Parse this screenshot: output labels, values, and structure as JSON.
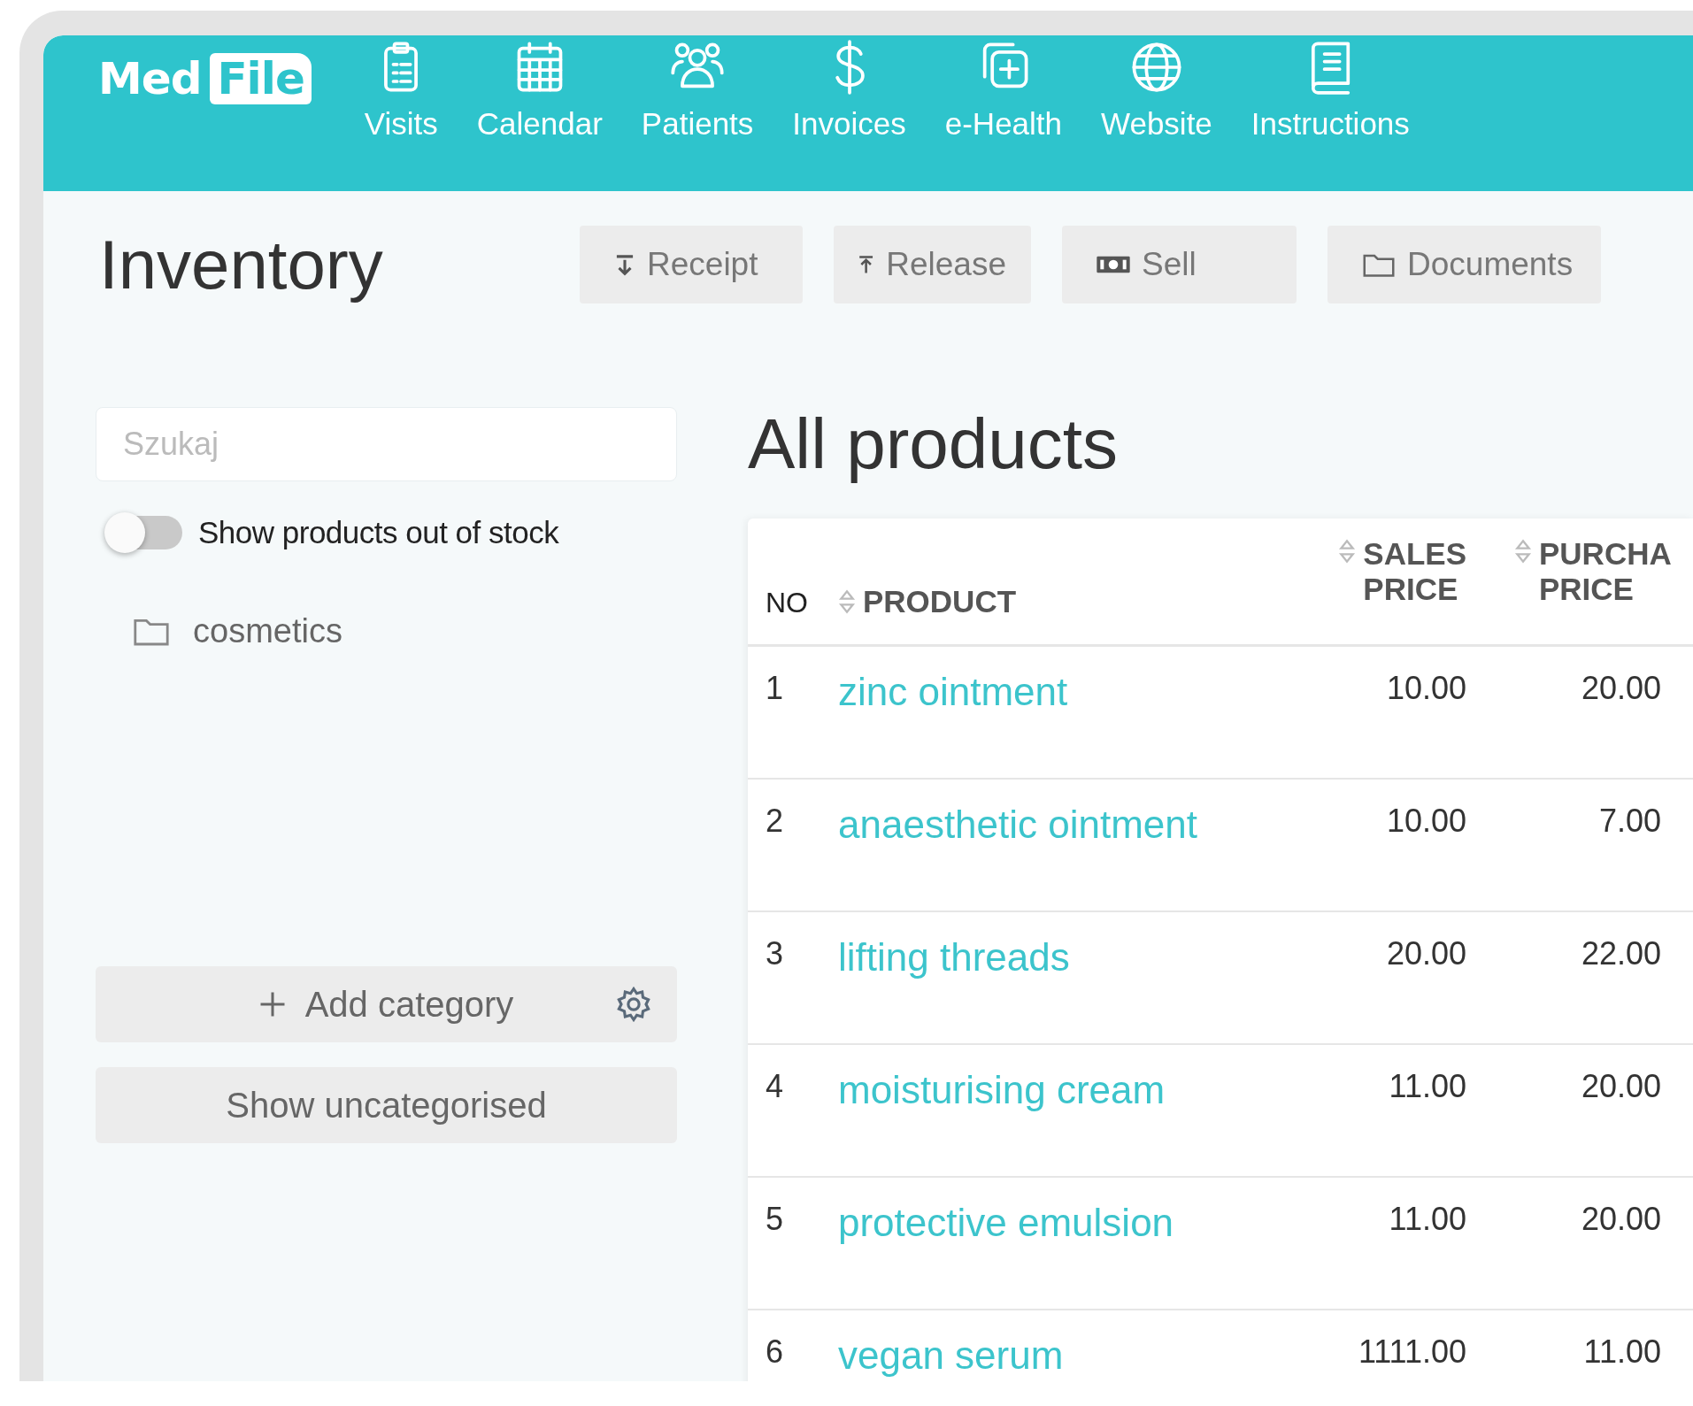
{
  "logo": {
    "parts": [
      "Med",
      "File"
    ]
  },
  "nav": [
    {
      "label": "Visits"
    },
    {
      "label": "Calendar"
    },
    {
      "label": "Patients"
    },
    {
      "label": "Invoices"
    },
    {
      "label": "e-Health"
    },
    {
      "label": "Website"
    },
    {
      "label": "Instructions"
    }
  ],
  "page_title": "Inventory",
  "toolbar": [
    {
      "label": "Receipt"
    },
    {
      "label": "Release"
    },
    {
      "label": "Sell"
    },
    {
      "label": "Documents"
    }
  ],
  "sidebar": {
    "search": {
      "placeholder": "Szukaj"
    },
    "toggle": {
      "label": "Show products out of stock",
      "on": false
    },
    "categories": [
      {
        "label": "cosmetics"
      }
    ],
    "add_button": "Add category",
    "uncategorised_button": "Show uncategorised"
  },
  "content_title": "All products",
  "table": {
    "columns": [
      {
        "label": "NO"
      },
      {
        "label": "PRODUCT"
      },
      {
        "label": "SALES\nPRICE"
      },
      {
        "label": "PURCHA\nPRICE"
      }
    ],
    "rows": [
      {
        "no": "1",
        "product": "zinc ointment",
        "sales": "10.00",
        "purchase": "20.00"
      },
      {
        "no": "2",
        "product": "anaesthetic ointment",
        "sales": "10.00",
        "purchase": "7.00"
      },
      {
        "no": "3",
        "product": "lifting threads",
        "sales": "20.00",
        "purchase": "22.00"
      },
      {
        "no": "4",
        "product": "moisturising cream",
        "sales": "11.00",
        "purchase": "20.00"
      },
      {
        "no": "5",
        "product": "protective emulsion",
        "sales": "11.00",
        "purchase": "20.00"
      },
      {
        "no": "6",
        "product": "vegan serum",
        "sales": "1111.00",
        "purchase": "11.00"
      }
    ]
  }
}
